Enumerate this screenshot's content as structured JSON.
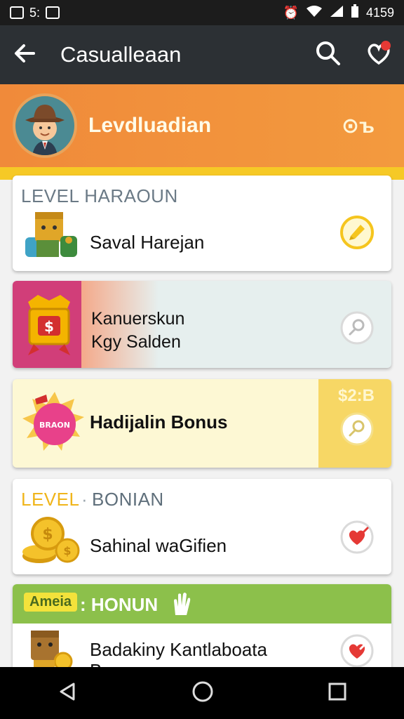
{
  "status": {
    "left_text": "5:",
    "right_text": "4159"
  },
  "appbar": {
    "title": "Casualleaan"
  },
  "profile": {
    "name": "Levdluadian",
    "badge": "⊙ъ"
  },
  "cards": [
    {
      "label": "LEVEL HARAOUN",
      "text": "Saval Harejan"
    },
    {
      "line1": "Kanuerskun",
      "line2": "Kgy Salden"
    },
    {
      "text": "Hadijalin Bonus",
      "side_value": "$2:B",
      "badge_text": "BRAON"
    },
    {
      "label_level": "LEVEL",
      "label_dot": "·",
      "label_rest": "BONIAN",
      "text": "Sahinal waGifien"
    },
    {
      "tag": "Ameia",
      "header": ": HONUN",
      "text": "Badakiny Kantlaboata",
      "text2": "Ba..."
    }
  ],
  "colors": {
    "orange": "#f08a3a",
    "yellow": "#f6c926",
    "green": "#8cc04b",
    "pink": "#d13e79",
    "dark": "#2c3034"
  }
}
